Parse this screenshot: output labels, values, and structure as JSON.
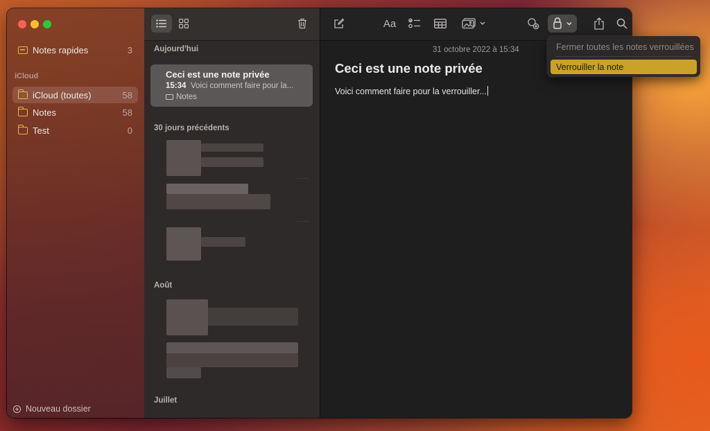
{
  "sidebar": {
    "quick_notes": {
      "label": "Notes rapides",
      "count": "3"
    },
    "section_title": "iCloud",
    "folders": [
      {
        "label": "iCloud (toutes)",
        "count": "58",
        "selected": true
      },
      {
        "label": "Notes",
        "count": "58",
        "selected": false
      },
      {
        "label": "Test",
        "count": "0",
        "selected": false
      }
    ],
    "new_folder_label": "Nouveau dossier"
  },
  "note_list": {
    "sections": {
      "today": "Aujourd'hui",
      "last30": "30 jours précédents",
      "august": "Août",
      "july": "Juillet"
    },
    "selected_note": {
      "title": "Ceci est une note privée",
      "time": "15:34",
      "preview": "Voici comment faire pour la...",
      "folder": "Notes"
    }
  },
  "editor": {
    "date": "31 octobre 2022 à 15:34",
    "title": "Ceci est une note privée",
    "body": "Voici comment faire pour la verrouiller..."
  },
  "toolbar": {
    "format_label": "Aa",
    "icons": [
      "compose-icon",
      "format-icon",
      "checklist-icon",
      "table-icon",
      "media-icon",
      "collaborate-icon",
      "lock-icon",
      "share-icon",
      "search-icon"
    ]
  },
  "lock_menu": {
    "items": [
      {
        "label": "Fermer toutes les notes verrouillées",
        "enabled": false
      },
      {
        "label": "Verrouiller la note",
        "enabled": true,
        "highlighted": true
      }
    ]
  },
  "colors": {
    "accent": "#c9a227",
    "folder_icon": "#e6b640"
  }
}
